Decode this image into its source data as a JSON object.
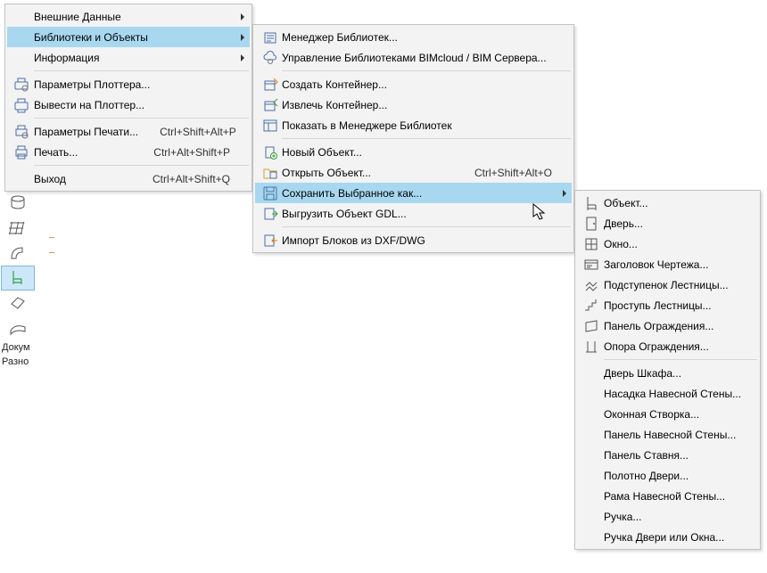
{
  "menu1": {
    "items": [
      {
        "label": "Внешние Данные",
        "icon": null,
        "arrow": true
      },
      {
        "label": "Библиотеки и Объекты",
        "icon": null,
        "arrow": true,
        "highlight": true
      },
      {
        "label": "Информация",
        "icon": null,
        "arrow": true
      },
      {
        "sep": true
      },
      {
        "label": "Параметры Плоттера...",
        "icon": "plotter-settings-icon"
      },
      {
        "label": "Вывести на Плоттер...",
        "icon": "plotter-icon"
      },
      {
        "sep": true
      },
      {
        "label": "Параметры Печати...",
        "icon": "print-settings-icon",
        "shortcut": "Ctrl+Shift+Alt+P"
      },
      {
        "label": "Печать...",
        "icon": "print-icon",
        "shortcut": "Ctrl+Alt+Shift+P"
      },
      {
        "sep": true
      },
      {
        "label": "Выход",
        "icon": null,
        "shortcut": "Ctrl+Alt+Shift+Q"
      }
    ]
  },
  "menu2": {
    "items": [
      {
        "label": "Менеджер Библиотек...",
        "icon": "library-manager-icon"
      },
      {
        "label": "Управление Библиотеками BIMcloud / BIM Сервера...",
        "icon": "bimcloud-icon"
      },
      {
        "sep": true
      },
      {
        "label": "Создать Контейнер...",
        "icon": "create-container-icon"
      },
      {
        "label": "Извлечь Контейнер...",
        "icon": "extract-container-icon"
      },
      {
        "label": "Показать в Менеджере Библиотек",
        "icon": "show-in-manager-icon"
      },
      {
        "sep": true
      },
      {
        "label": "Новый Объект...",
        "icon": "new-object-icon"
      },
      {
        "label": "Открыть Объект...",
        "icon": "open-object-icon",
        "shortcut": "Ctrl+Shift+Alt+O"
      },
      {
        "label": "Сохранить Выбранное как...",
        "icon": "save-as-icon",
        "arrow": true,
        "highlight": true
      },
      {
        "label": "Выгрузить Объект GDL...",
        "icon": "export-gdl-icon"
      },
      {
        "sep": true
      },
      {
        "label": "Импорт Блоков из DXF/DWG",
        "icon": "import-dxf-icon"
      }
    ]
  },
  "menu3": {
    "items": [
      {
        "label": "Объект...",
        "icon": "object-icon"
      },
      {
        "label": "Дверь...",
        "icon": "door-icon"
      },
      {
        "label": "Окно...",
        "icon": "window-icon"
      },
      {
        "label": "Заголовок Чертежа...",
        "icon": "drawing-title-icon"
      },
      {
        "label": "Подступенок Лестницы...",
        "icon": "stair-riser-icon"
      },
      {
        "label": "Проступь Лестницы...",
        "icon": "stair-tread-icon"
      },
      {
        "label": "Панель Ограждения...",
        "icon": "railing-panel-icon"
      },
      {
        "label": "Опора Ограждения...",
        "icon": "railing-post-icon"
      },
      {
        "sep": true
      },
      {
        "label": "Дверь Шкафа..."
      },
      {
        "label": "Насадка Навесной Стены..."
      },
      {
        "label": "Оконная Створка..."
      },
      {
        "label": "Панель Навесной Стены..."
      },
      {
        "label": "Панель Ставня..."
      },
      {
        "label": "Полотно Двери..."
      },
      {
        "label": "Рама Навесной Стены..."
      },
      {
        "label": "Ручка..."
      },
      {
        "label": "Ручка Двери или Окна..."
      }
    ]
  },
  "rail": {
    "labels": [
      "Докум",
      "Разно"
    ]
  }
}
